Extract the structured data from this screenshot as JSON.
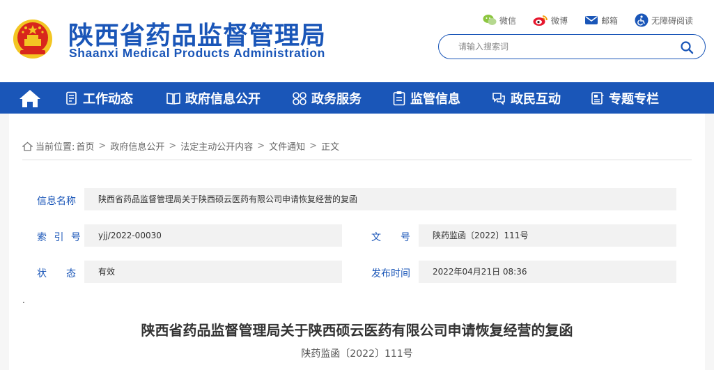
{
  "header": {
    "logo_cn": "陕西省药品监督管理局",
    "logo_en": "Shaanxi Medical Products Administration",
    "links": {
      "wechat": "微信",
      "weibo": "微博",
      "mail": "邮箱",
      "accessibility": "无障碍阅读"
    },
    "search": {
      "placeholder": "请输入搜索词"
    }
  },
  "nav": {
    "items": [
      {
        "label": "工作动态"
      },
      {
        "label": "政府信息公开"
      },
      {
        "label": "政务服务"
      },
      {
        "label": "监管信息"
      },
      {
        "label": "政民互动"
      },
      {
        "label": "专题专栏"
      }
    ]
  },
  "breadcrumb": {
    "prefix": "当前位置:",
    "items": [
      "首页",
      "政府信息公开",
      "法定主动公开内容",
      "文件通知",
      "正文"
    ],
    "separator": ">"
  },
  "info": {
    "name_label": "信息名称",
    "name_value": "陕西省药品监督管理局关于陕西硕云医药有限公司申请恢复经营的复函",
    "index_label": "索 引 号",
    "index_value": "yjj/2022-00030",
    "docno_label": "文　　号",
    "docno_value": "陕药监函〔2022〕111号",
    "status_label": "状　　态",
    "status_value": "有效",
    "date_label": "发布时间",
    "date_value": "2022年04月21日 08:36"
  },
  "article": {
    "dot": ".",
    "title": "陕西省药品监督管理局关于陕西硕云医药有限公司申请恢复经营的复函",
    "doc_number": "陕药监函〔2022〕111号"
  },
  "colors": {
    "brand": "#1a56b8",
    "emblem_red": "#d8261c",
    "emblem_gold": "#f3c623"
  }
}
